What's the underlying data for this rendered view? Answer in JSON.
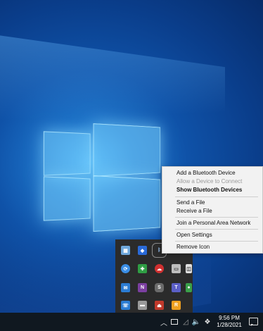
{
  "context_menu": {
    "items": [
      {
        "label": "Add a Bluetooth Device",
        "state": "normal"
      },
      {
        "label": "Allow a Device to Connect",
        "state": "disabled"
      },
      {
        "label": "Show Bluetooth Devices",
        "state": "default"
      },
      {
        "label": "Send a File",
        "state": "normal"
      },
      {
        "label": "Receive a File",
        "state": "normal"
      },
      {
        "label": "Join a Personal Area Network",
        "state": "normal"
      },
      {
        "label": "Open Settings",
        "state": "normal"
      },
      {
        "label": "Remove Icon",
        "state": "normal"
      }
    ]
  },
  "tray_overflow": {
    "icons": [
      "app-icon",
      "shield-icon",
      "bluetooth-icon",
      "sync-icon",
      "security-icon",
      "cloud-icon",
      "battery-icon",
      "window-icon",
      "mail-icon",
      "onenote-icon",
      "skype-icon",
      "teams-icon",
      "chat-icon",
      "phone-icon",
      "drive-icon",
      "usb-icon",
      "remote-icon"
    ],
    "colors": {
      "app": "#6fa8dc",
      "shield": "#2a6ad8",
      "bluetooth": "#9ecbff",
      "sync": "#3a8ee6",
      "security": "#2f9e44",
      "cloud": "#d03030",
      "battery": "#bdbdbd",
      "window": "#e0e0e0",
      "mail": "#2b7cd3",
      "onenote": "#7b3fa0",
      "skype": "#6b6b6b",
      "teams": "#5b5fc7",
      "chat": "#3aa04a",
      "phone": "#2b7cd3",
      "drive": "#9a9a9a",
      "usb": "#c0392b",
      "remote": "#f0a020"
    }
  },
  "taskbar": {
    "time": "9:56 PM",
    "date": "1/28/2021",
    "system_icons": [
      "chevron-up-icon",
      "monitor-icon",
      "wifi-icon",
      "volume-icon",
      "dropbox-icon",
      "notification-icon"
    ]
  }
}
